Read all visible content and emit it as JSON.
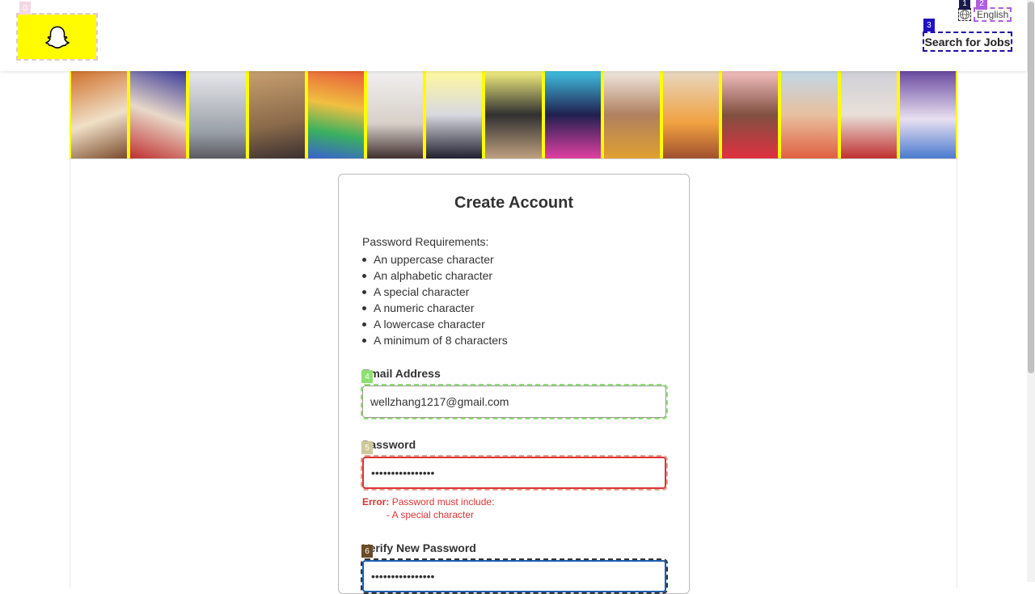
{
  "header": {
    "language_label": "English",
    "search_jobs_label": "Search for Jobs"
  },
  "badges": [
    "0",
    "1",
    "2",
    "3",
    "4",
    "5",
    "6"
  ],
  "card": {
    "title": "Create Account",
    "requirements_title": "Password Requirements:",
    "requirements": [
      "An uppercase character",
      "An alphabetic character",
      "A special character",
      "A numeric character",
      "A lowercase character",
      "A minimum of 8 characters"
    ],
    "email_label": "Email Address",
    "email_value": "wellzhang1217@gmail.com",
    "password_label": "Password",
    "password_value": "••••••••••••••••",
    "error_prefix": "Error:",
    "error_text": "Password must include:",
    "error_detail": "- A special character",
    "verify_label": "Verify New Password",
    "verify_value": "••••••••••••••••"
  },
  "colors": {
    "brand_yellow": "#fffc00",
    "error_red": "#d33333",
    "focus_blue": "#1b5fb0"
  }
}
